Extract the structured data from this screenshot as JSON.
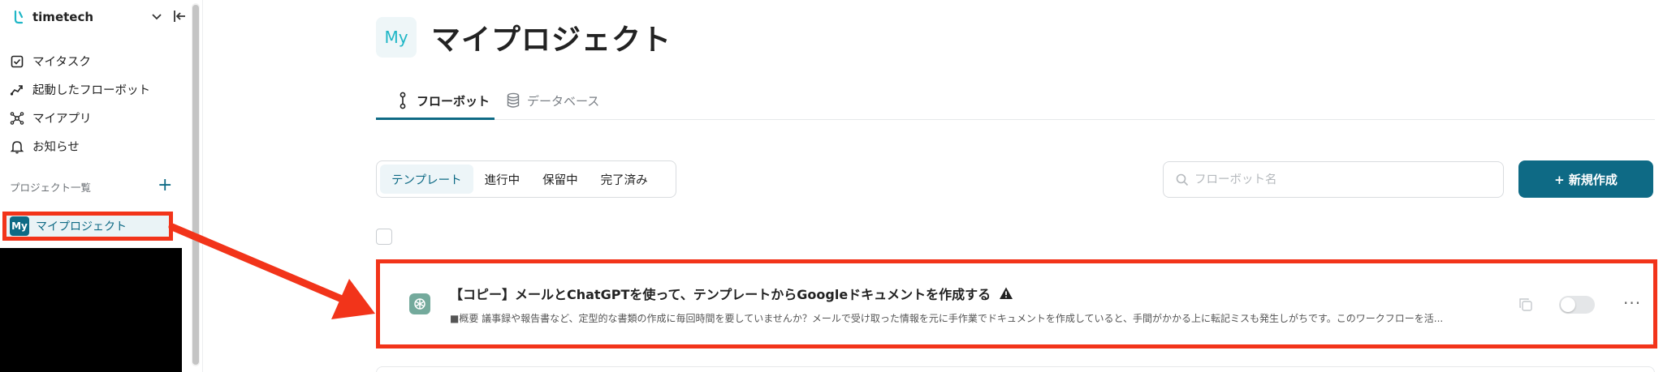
{
  "workspace": {
    "name": "timetech"
  },
  "sidebar": {
    "nav": [
      {
        "label": "マイタスク",
        "icon": "checkbox-icon"
      },
      {
        "label": "起動したフローボット",
        "icon": "flow-trend-icon"
      },
      {
        "label": "マイアプリ",
        "icon": "apps-hub-icon"
      },
      {
        "label": "お知らせ",
        "icon": "bell-icon"
      }
    ],
    "projects_heading": "プロジェクト一覧",
    "add_symbol": "+",
    "project": {
      "badge": "My",
      "label": "マイプロジェクト"
    }
  },
  "page": {
    "badge": "My",
    "title": "マイプロジェクト"
  },
  "tabs": [
    {
      "label": "フローボット",
      "icon": "flow-icon",
      "active": true
    },
    {
      "label": "データベース",
      "icon": "database-icon",
      "active": false
    }
  ],
  "filters": [
    {
      "label": "テンプレート",
      "active": true
    },
    {
      "label": "進行中",
      "active": false
    },
    {
      "label": "保留中",
      "active": false
    },
    {
      "label": "完了済み",
      "active": false
    }
  ],
  "search": {
    "placeholder": "フローボット名",
    "value": ""
  },
  "new_button": {
    "label": "+ 新規作成"
  },
  "flowbots": [
    {
      "title": "【コピー】メールとChatGPTを使って、テンプレートからGoogleドキュメントを作成する",
      "description": "■概要 議事録や報告書など、定型的な書類の作成に毎回時間を要していませんか？メールで受け取った情報を元に手作業でドキュメントを作成していると、手間がかかる上に転記ミスも発生しがちです。このワークフローを活...",
      "app_icon": "chatgpt-icon",
      "warning": true,
      "enabled": false
    }
  ],
  "colors": {
    "accent": "#0e6a85",
    "annotation": "#f2341a",
    "badge_text": "#1fb6c6"
  }
}
